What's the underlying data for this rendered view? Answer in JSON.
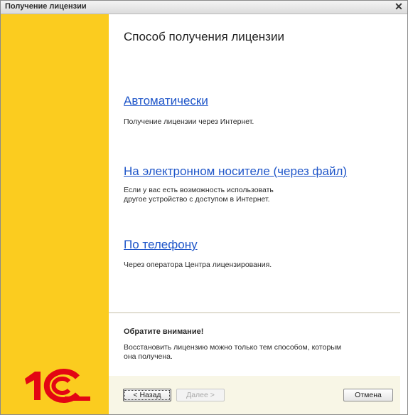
{
  "window": {
    "title": "Получение лицензии"
  },
  "page": {
    "heading": "Способ получения лицензии"
  },
  "options": [
    {
      "label": "Автоматически",
      "description": [
        "Получение лицензии через Интернет."
      ]
    },
    {
      "label": "На электронном носителе (через файл)",
      "description": [
        "Если у вас есть возможность использовать",
        "другое устройство с доступом в Интернет."
      ]
    },
    {
      "label": "По телефону",
      "description": [
        "Через оператора Центра лицензирования."
      ]
    }
  ],
  "notice": {
    "title": "Обратите внимание!",
    "lines": [
      "Восстановить лицензию можно только тем способом, которым",
      "она получена."
    ]
  },
  "buttons": {
    "back": "< Назад",
    "next": "Далее >",
    "cancel": "Отмена"
  },
  "logo": {
    "text": "1С",
    "color": "#e30613"
  },
  "colors": {
    "side_panel": "#fbcc1f",
    "link": "#1f56c9"
  }
}
